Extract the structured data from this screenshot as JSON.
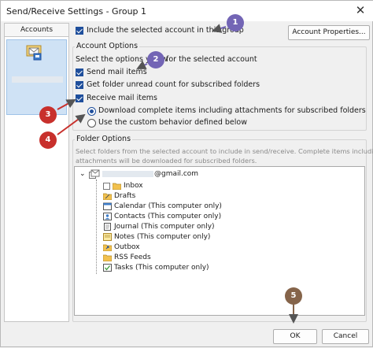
{
  "window": {
    "title": "Send/Receive Settings - Group 1",
    "close_label": "✕"
  },
  "sidebar": {
    "header": "Accounts"
  },
  "top": {
    "include_label": "Include the selected account in this group",
    "account_properties_label": "Account Properties..."
  },
  "account_options": {
    "group_title": "Account Options",
    "intro_left": "Select the options you w",
    "intro_right": "for the selected account",
    "send_mail_label": "Send mail items",
    "folder_unread_label": "Get folder unread count for subscribed folders",
    "receive_mail_label": "Receive mail items",
    "download_complete_label": "Download complete items including attachments for subscribed folders",
    "custom_behavior_label": "Use the custom behavior defined below"
  },
  "folder_options": {
    "group_title": "Folder Options",
    "description_line1": "Select folders from the selected account to include in send/receive. Complete items including",
    "description_line2": "attachments will be downloaded for subscribed folders.",
    "account_suffix": "@gmail.com",
    "expander": "⌄",
    "folders": [
      {
        "label": "Inbox",
        "icon": "folder-icon"
      },
      {
        "label": "Drafts",
        "icon": "drafts-folder-icon"
      },
      {
        "label": "Calendar (This computer only)",
        "icon": "calendar-icon"
      },
      {
        "label": "Contacts (This computer only)",
        "icon": "contacts-icon"
      },
      {
        "label": "Journal (This computer only)",
        "icon": "journal-icon"
      },
      {
        "label": "Notes (This computer only)",
        "icon": "notes-icon"
      },
      {
        "label": "Outbox",
        "icon": "outbox-icon"
      },
      {
        "label": "RSS Feeds",
        "icon": "rss-folder-icon"
      },
      {
        "label": "Tasks (This computer only)",
        "icon": "tasks-icon"
      }
    ]
  },
  "footer": {
    "ok_label": "OK",
    "cancel_label": "Cancel"
  },
  "annotations": {
    "b1": "1",
    "b2": "2",
    "b3": "3",
    "b4": "4",
    "b5": "5"
  },
  "colors": {
    "accent": "#1f4f9c",
    "badge_purple": "#7365b5",
    "badge_red": "#c8302c",
    "badge_brown": "#85644a"
  }
}
